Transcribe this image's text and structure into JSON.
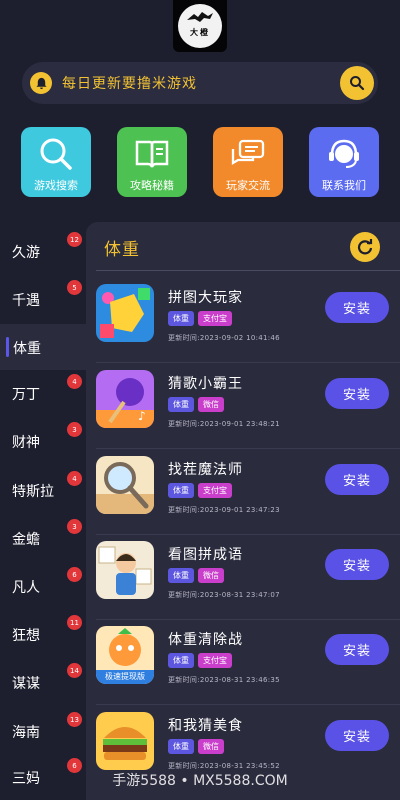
{
  "header": {
    "logo_text": "大橙"
  },
  "search": {
    "text": "每日更新要撸米游戏"
  },
  "quick_actions": [
    {
      "label": "游戏搜索",
      "icon": "search-icon",
      "color": "#3ec9de"
    },
    {
      "label": "攻略秘籍",
      "icon": "book-icon",
      "color": "#4dc151"
    },
    {
      "label": "玩家交流",
      "icon": "chat-icon",
      "color": "#f28a2b"
    },
    {
      "label": "联系我们",
      "icon": "headset-icon",
      "color": "#5c6cf0"
    }
  ],
  "categories": [
    {
      "label": "久游",
      "badge": "12"
    },
    {
      "label": "千遇",
      "badge": "5"
    },
    {
      "label": "体重",
      "badge": ""
    },
    {
      "label": "万丁",
      "badge": "4"
    },
    {
      "label": "财神",
      "badge": "3"
    },
    {
      "label": "特斯拉",
      "badge": "4"
    },
    {
      "label": "金蟾",
      "badge": "3"
    },
    {
      "label": "凡人",
      "badge": "6"
    },
    {
      "label": "狂想",
      "badge": "11"
    },
    {
      "label": "谋谋",
      "badge": "14"
    },
    {
      "label": "海南",
      "badge": "13"
    },
    {
      "label": "三妈",
      "badge": "6"
    }
  ],
  "active_category": "体重",
  "panel": {
    "title": "体重",
    "install_label": "安装"
  },
  "games": [
    {
      "name": "拼图大玩家",
      "tags": [
        "体重",
        "支付宝"
      ],
      "time": "更新时间:2023-09-02 10:41:46"
    },
    {
      "name": "猜歌小霸王",
      "tags": [
        "体重",
        "微信"
      ],
      "time": "更新时间:2023-09-01 23:48:21"
    },
    {
      "name": "找茬魔法师",
      "tags": [
        "体重",
        "支付宝"
      ],
      "time": "更新时间:2023-09-01 23:47:23"
    },
    {
      "name": "看图拼成语",
      "tags": [
        "体重",
        "微信"
      ],
      "time": "更新时间:2023-08-31 23:47:07"
    },
    {
      "name": "体重清除战",
      "tags": [
        "体重",
        "支付宝"
      ],
      "time": "更新时间:2023-08-31 23:46:35",
      "thumb_text": "极速提现版"
    },
    {
      "name": "和我猜美食",
      "tags": [
        "体重",
        "微信"
      ],
      "time": "更新时间:2023-08-31 23:45:52"
    }
  ],
  "watermark": "手游5588 • MX5588.COM"
}
